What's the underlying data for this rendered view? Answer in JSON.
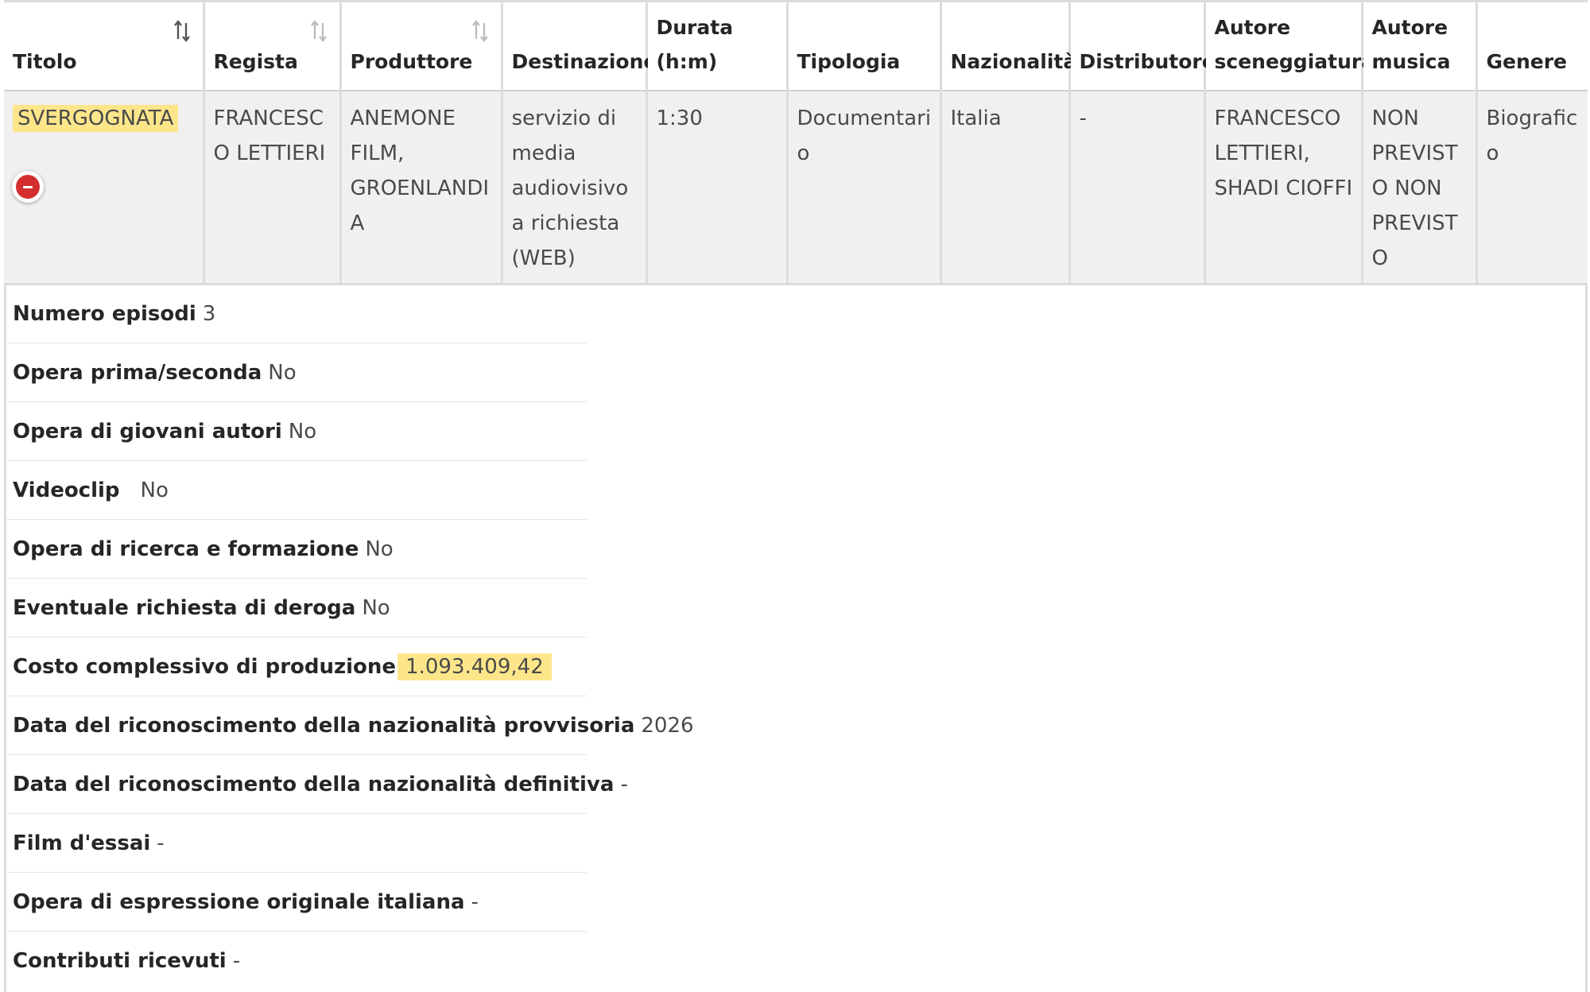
{
  "colors": {
    "highlight": "#fde68a",
    "remove": "#d32f2f",
    "row_bg": "#f0f0f0"
  },
  "table": {
    "columns": [
      {
        "label": "Titolo",
        "sortable": true,
        "sort_state": "active"
      },
      {
        "label": "Regista",
        "sortable": true,
        "sort_state": "inactive"
      },
      {
        "label": "Produttore",
        "sortable": true,
        "sort_state": "inactive"
      },
      {
        "label": "Destinazione",
        "sortable": false
      },
      {
        "label": "Durata (h:m)",
        "sortable": false
      },
      {
        "label": "Tipologia",
        "sortable": false
      },
      {
        "label": "Nazionalità",
        "sortable": false
      },
      {
        "label": "Distributore",
        "sortable": false
      },
      {
        "label": "Autore sceneggiatura",
        "sortable": false
      },
      {
        "label": "Autore musica",
        "sortable": false
      },
      {
        "label": "Genere",
        "sortable": false
      }
    ],
    "row": {
      "titolo": "SVERGOGNATA",
      "regista": "FRANCESCO LETTIERI",
      "produttore": "ANEMONE FILM, GROENLANDIA",
      "destinazione": "servizio di media audiovisivo a richiesta (WEB)",
      "durata": "1:30",
      "tipologia": "Documentario",
      "nazionalita": "Italia",
      "distributore": "-",
      "autore_sceneggiatura": "FRANCESCO LETTIERI, SHADI CIOFFI",
      "autore_musica": "NON PREVISTO NON PREVISTO",
      "genere": "Biografico",
      "remove_icon": "minus-circle-icon"
    }
  },
  "details": [
    {
      "label": "Numero episodi",
      "value": "3"
    },
    {
      "label": "Opera prima/seconda",
      "value": "No"
    },
    {
      "label": "Opera di giovani autori",
      "value": "No"
    },
    {
      "label": "Videoclip",
      "value": "No"
    },
    {
      "label": "Opera di ricerca e formazione",
      "value": "No"
    },
    {
      "label": "Eventuale richiesta di deroga",
      "value": "No"
    },
    {
      "label": "Costo complessivo di produzione",
      "value": "1.093.409,42",
      "highlighted": true
    },
    {
      "label": "Data del riconoscimento della nazionalità provvisoria",
      "value": "2026"
    },
    {
      "label": "Data del riconoscimento della nazionalità definitiva",
      "value": "-"
    },
    {
      "label": "Film d'essai",
      "value": "-"
    },
    {
      "label": "Opera di espressione originale italiana",
      "value": "-"
    },
    {
      "label": "Contributi ricevuti",
      "value": "-"
    }
  ]
}
